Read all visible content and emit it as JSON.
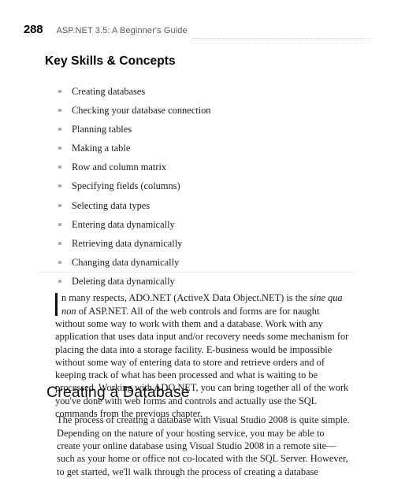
{
  "running_head": {
    "page_number": "288",
    "book_title": "ASP.NET 3.5: A Beginner's Guide"
  },
  "skills_box": {
    "heading": "Key Skills & Concepts",
    "items": [
      "Creating databases",
      "Checking your database connection",
      "Planning tables",
      "Making a table",
      "Row and column matrix",
      "Specifying fields (columns)",
      "Selecting data types",
      "Entering data dynamically",
      "Retrieving data dynamically",
      "Changing data dynamically",
      "Deleting data dynamically"
    ],
    "bullet_color": "#a0a0a0"
  },
  "intro_paragraph": {
    "drop_cap": "I",
    "part_1": "n many respects, ADO.NET (ActiveX Data Object.NET) is the ",
    "italic_phrase": "sine qua non",
    "part_2": " of ASP.NET. All of the web controls and forms are for naught without some way to work with them and a database. Work with any application that uses data input and/or recovery needs some mechanism for placing the data into a storage facility. E-business would be impossible without some way of entering data to store and retrieve orders and of keeping track of what has been processed and what is waiting to be processed. Working with ADO.NET, you can bring together all of the work you've done with web forms and controls and actually use the SQL commands from the previous chapter."
  },
  "section": {
    "heading": "Creating a Database",
    "paragraph": "The process of creating a database with Visual Studio 2008 is quite simple. Depending on the nature of your hosting service, you may be able to create your online database using Visual Studio 2008 in a remote site—such as your home or office not co-located with the SQL Server. However, to get started, we'll walk through the process of creating a database"
  }
}
